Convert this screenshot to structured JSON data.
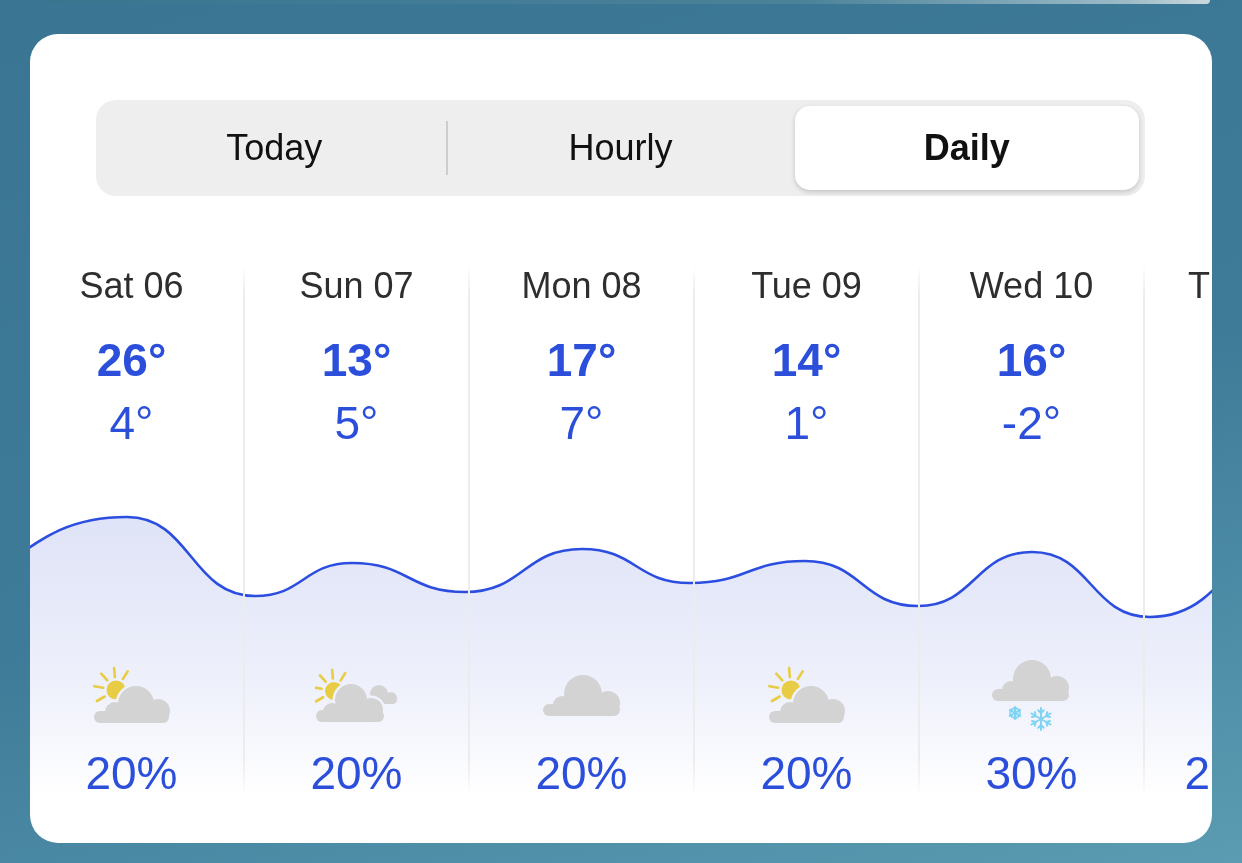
{
  "segmented_control": {
    "tabs": [
      {
        "label": "Today",
        "selected": false
      },
      {
        "label": "Hourly",
        "selected": false
      },
      {
        "label": "Daily",
        "selected": true
      }
    ]
  },
  "forecast": {
    "days": [
      {
        "day": "Sat 06",
        "high": "26°",
        "low": "4°",
        "kind": "sun_cloud",
        "precipitation": "20%"
      },
      {
        "day": "Sun 07",
        "high": "13°",
        "low": "5°",
        "kind": "sun_clouds",
        "precipitation": "20%"
      },
      {
        "day": "Mon 08",
        "high": "17°",
        "low": "7°",
        "kind": "cloud",
        "precipitation": "20%"
      },
      {
        "day": "Tue 09",
        "high": "14°",
        "low": "1°",
        "kind": "sun_cloud",
        "precipitation": "20%"
      },
      {
        "day": "Wed 10",
        "high": "16°",
        "low": "-2°",
        "kind": "snow",
        "precipitation": "30%"
      }
    ],
    "cut_off_day": {
      "day": "T",
      "precipitation": "2"
    }
  }
}
